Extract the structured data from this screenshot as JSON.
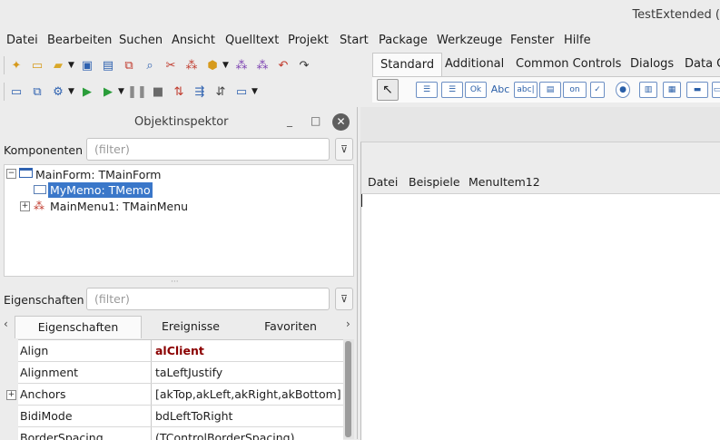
{
  "window": {
    "title": "TestExtended ("
  },
  "menu": [
    "Datei",
    "Bearbeiten",
    "Suchen",
    "Ansicht",
    "Quelltext",
    "Projekt",
    "Start",
    "Package",
    "Werkzeuge",
    "Fenster",
    "Hilfe"
  ],
  "palette": {
    "tabs": [
      "Standard",
      "Additional",
      "Common Controls",
      "Dialogs",
      "Data C"
    ],
    "active_tab": "Standard",
    "icons": {
      "ok": "Ok",
      "abc": "Abc",
      "abcbox": "abc|",
      "toggle": "on"
    }
  },
  "inspector": {
    "title": "Objektinspektor",
    "components_label": "Komponenten",
    "components_filter_placeholder": "(filter)",
    "tree": [
      {
        "label": "MainForm: TMainForm",
        "selected": false
      },
      {
        "label": "MyMemo: TMemo",
        "selected": true
      },
      {
        "label": "MainMenu1: TMainMenu",
        "selected": false
      }
    ],
    "properties_label": "Eigenschaften",
    "properties_filter_placeholder": "(filter)",
    "tabs": [
      "Eigenschaften",
      "Ereignisse",
      "Favoriten"
    ],
    "active_tab": "Eigenschaften",
    "properties": [
      {
        "name": "Align",
        "value": "alClient",
        "modified": true
      },
      {
        "name": "Alignment",
        "value": "taLeftJustify",
        "modified": false
      },
      {
        "name": "Anchors",
        "value": "[akTop,akLeft,akRight,akBottom]",
        "modified": false
      },
      {
        "name": "BidiMode",
        "value": "bdLeftToRight",
        "modified": false
      },
      {
        "name": "BorderSpacing",
        "value": "(TControlBorderSpacing)",
        "modified": false
      }
    ]
  },
  "form": {
    "menu": [
      "Datei",
      "Beispiele",
      "MenuItem12"
    ]
  },
  "colors": {
    "selection": "#3a77c9",
    "modified_value": "#8b0000",
    "accent_icon": "#2a5fa8"
  }
}
